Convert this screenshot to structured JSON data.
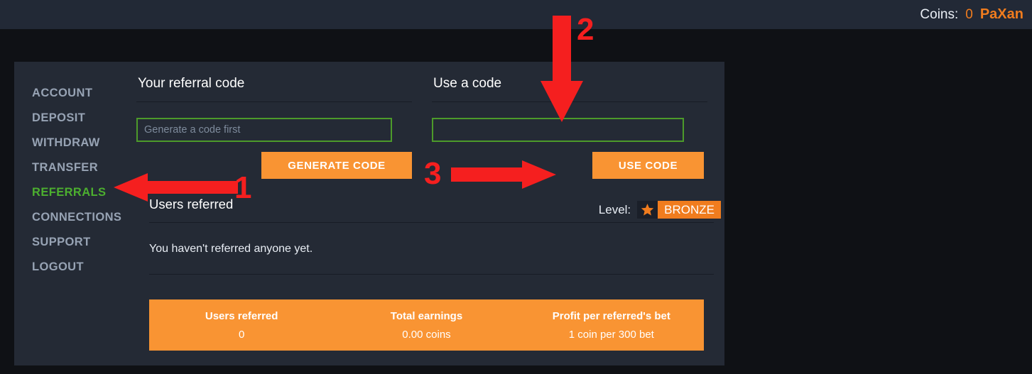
{
  "topbar": {
    "coins_label": "Coins:",
    "coins_value": "0",
    "username": "PaXan"
  },
  "sidebar": {
    "items": [
      {
        "label": "ACCOUNT",
        "active": false
      },
      {
        "label": "DEPOSIT",
        "active": false
      },
      {
        "label": "WITHDRAW",
        "active": false
      },
      {
        "label": "TRANSFER",
        "active": false
      },
      {
        "label": "REFERRALS",
        "active": true
      },
      {
        "label": "CONNECTIONS",
        "active": false
      },
      {
        "label": "SUPPORT",
        "active": false
      },
      {
        "label": "LOGOUT",
        "active": false
      }
    ]
  },
  "referral_code": {
    "title": "Your referral code",
    "input_placeholder": "Generate a code first",
    "input_value": "",
    "button_label": "GENERATE CODE"
  },
  "use_code": {
    "title": "Use a code",
    "input_placeholder": "",
    "input_value": "",
    "button_label": "USE CODE"
  },
  "level": {
    "label": "Level:",
    "icon": "star-icon",
    "name": "BRONZE"
  },
  "users_referred": {
    "title": "Users referred",
    "empty_message": "You haven't referred anyone yet."
  },
  "stats": [
    {
      "label": "Users referred",
      "value": "0"
    },
    {
      "label": "Total earnings",
      "value": "0.00 coins"
    },
    {
      "label": "Profit per referred's bet",
      "value": "1 coin per 300 bet"
    }
  ],
  "annotations": [
    {
      "number": "1",
      "direction": "left",
      "target": "referrals-nav-item"
    },
    {
      "number": "2",
      "direction": "down",
      "target": "use-code-input"
    },
    {
      "number": "3",
      "direction": "right",
      "target": "use-code-button"
    }
  ],
  "colors": {
    "accent_orange": "#f99433",
    "brand_orange": "#f07c1e",
    "active_green": "#4caf2f",
    "input_border_green": "#4c9a2a",
    "panel_bg": "#242a35",
    "page_bg": "#0f1115",
    "topbar_bg": "#222936",
    "annotation_red": "#f51f1f"
  }
}
